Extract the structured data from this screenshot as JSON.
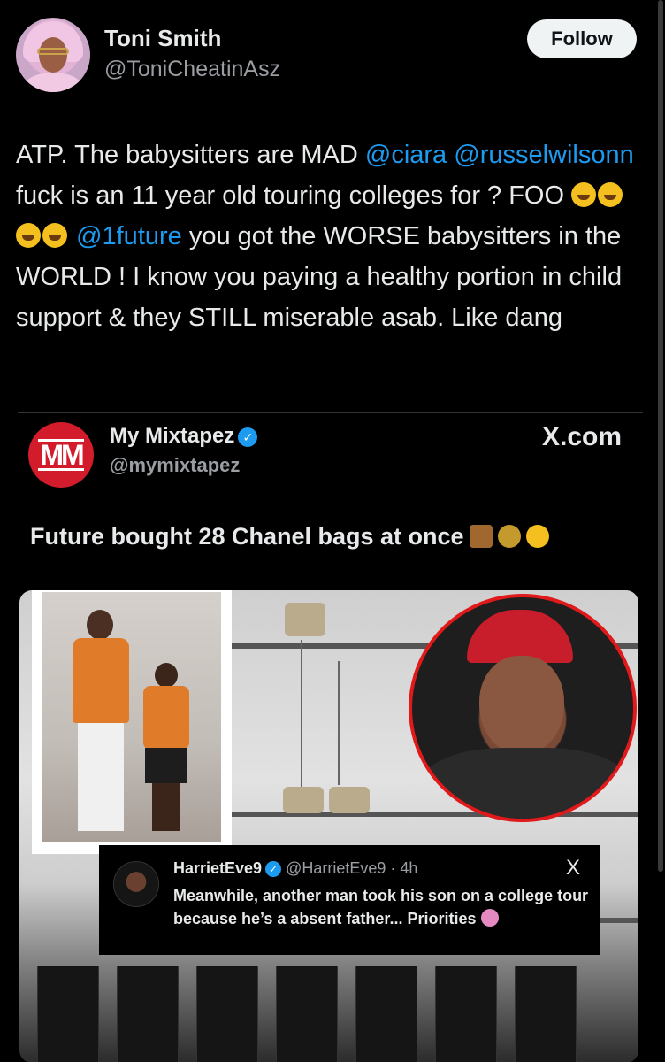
{
  "author": {
    "display_name": "Toni Smith",
    "handle": "@ToniCheatinAsz",
    "follow_label": "Follow"
  },
  "tweet": {
    "seg1": "ATP. The babysitters are MAD ",
    "mention1": "@ciara",
    "mention2": "@russelwilsonn",
    "seg2": " fuck is an 11 year old touring colleges for ? FOO ",
    "mention3": "@1future",
    "seg3": " you got the WORSE babysitters in the WORLD ! I know you paying a healthy portion in child support & they STILL miserable asab. Like dang"
  },
  "embed": {
    "logo_text": "MM",
    "name": "My Mixtapez",
    "handle": "@mymixtapez",
    "site": "X.com",
    "headline": "Future bought 28 Chanel bags at once",
    "icons": [
      "handbag-emoji",
      "money-bag-emoji",
      "flushed-face-emoji"
    ]
  },
  "reply": {
    "name": "HarrietEve9",
    "meta": "@HarrietEve9 · 4h",
    "x_logo": "X",
    "text": "Meanwhile, another man took his son on a college tour because he’s a absent father... Priorities"
  },
  "colors": {
    "background": "#000000",
    "link": "#1d9bf0",
    "muted": "#9a9ea3",
    "brand_red": "#d21b2b"
  }
}
